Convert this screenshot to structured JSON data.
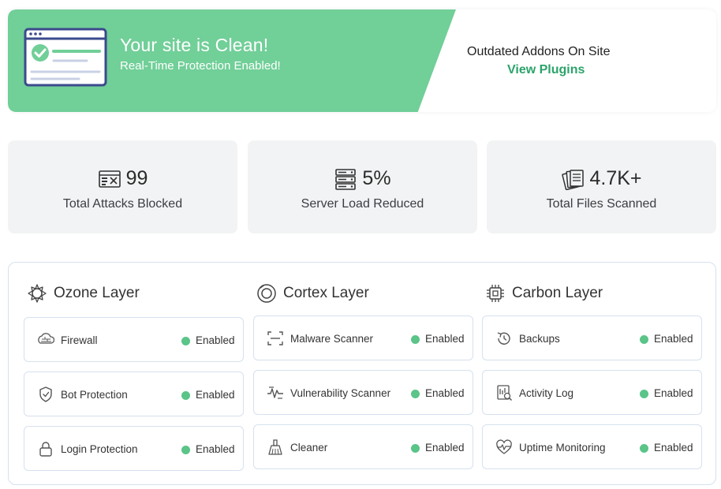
{
  "banner": {
    "title": "Your site is Clean!",
    "subtitle": "Real-Time Protection Enabled!",
    "outdated_text": "Outdated Addons On Site",
    "view_plugins_label": "View Plugins",
    "green_color": "#71cf98",
    "link_color": "#2ba36a"
  },
  "stats": [
    {
      "icon": "attack-blocked-icon",
      "value": "99",
      "label": "Total Attacks Blocked"
    },
    {
      "icon": "server-icon",
      "value": "5%",
      "label": "Server Load Reduced"
    },
    {
      "icon": "files-icon",
      "value": "4.7K+",
      "label": "Total Files Scanned"
    }
  ],
  "layers": [
    {
      "title": "Ozone Layer",
      "icon": "ozone-icon",
      "features": [
        {
          "label": "Firewall",
          "status": "Enabled",
          "icon": "firewall-icon"
        },
        {
          "label": "Bot Protection",
          "status": "Enabled",
          "icon": "shield-check-icon"
        },
        {
          "label": "Login Protection",
          "status": "Enabled",
          "icon": "lock-icon"
        }
      ]
    },
    {
      "title": "Cortex Layer",
      "icon": "cortex-icon",
      "features": [
        {
          "label": "Malware Scanner",
          "status": "Enabled",
          "icon": "scan-frame-icon"
        },
        {
          "label": "Vulnerability Scanner",
          "status": "Enabled",
          "icon": "pulse-scan-icon"
        },
        {
          "label": "Cleaner",
          "status": "Enabled",
          "icon": "broom-icon"
        }
      ]
    },
    {
      "title": "Carbon Layer",
      "icon": "carbon-chip-icon",
      "features": [
        {
          "label": "Backups",
          "status": "Enabled",
          "icon": "backup-icon"
        },
        {
          "label": "Activity Log",
          "status": "Enabled",
          "icon": "activity-log-icon"
        },
        {
          "label": "Uptime Monitoring",
          "status": "Enabled",
          "icon": "heart-pulse-icon"
        }
      ]
    }
  ],
  "status_color": "#5bc488"
}
